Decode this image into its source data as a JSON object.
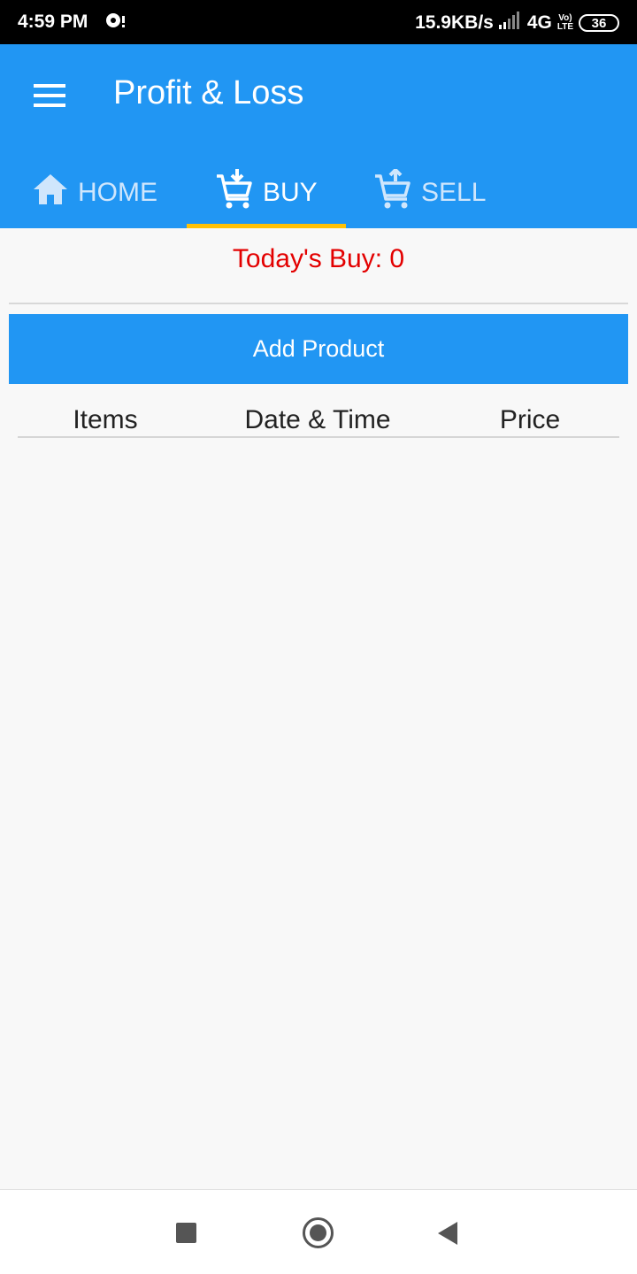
{
  "status_bar": {
    "time": "4:59 PM",
    "net_speed": "15.9KB/s",
    "network": "4G",
    "volte": "Vo)",
    "lte": "LTE",
    "battery": "36"
  },
  "app_bar": {
    "title": "Profit & Loss",
    "menu_icon": "hamburger-menu-icon"
  },
  "tabs": [
    {
      "label": "HOME",
      "icon": "home-icon"
    },
    {
      "label": "BUY",
      "icon": "cart-download-icon"
    },
    {
      "label": "SELL",
      "icon": "cart-upload-icon"
    }
  ],
  "active_tab": "BUY",
  "buy": {
    "todays_buy": "Today's Buy: 0",
    "add_button": "Add Product",
    "columns": [
      "Items",
      "Date & Time",
      "Price"
    ]
  },
  "colors": {
    "primary": "#2196f3",
    "indicator": "#ffc107",
    "todays_text": "#e30000"
  },
  "nav_bar": {
    "icons": [
      "recents-square-icon",
      "home-circle-icon",
      "back-triangle-icon"
    ]
  }
}
